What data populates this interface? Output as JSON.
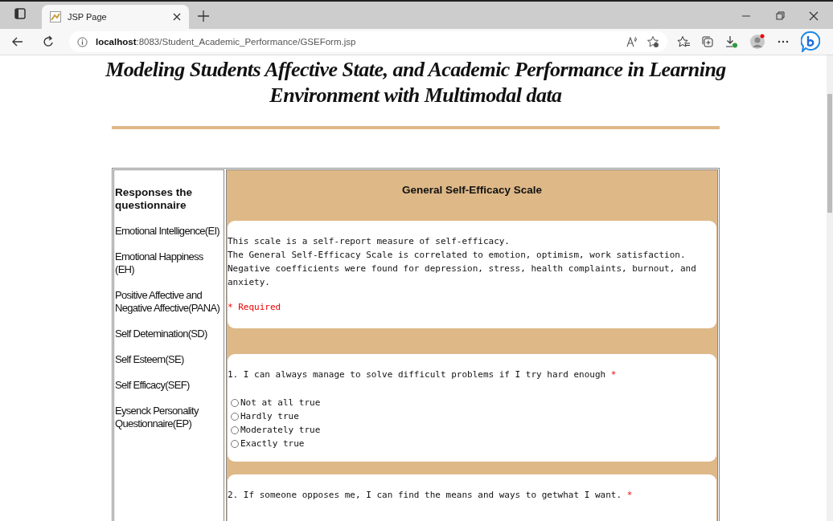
{
  "browser": {
    "tab_title": "JSP Page",
    "url_host": "localhost",
    "url_path": ":8083/Student_Academic_Performance/GSEForm.jsp"
  },
  "page": {
    "title": "Modeling Students Affective State, and Academic Performance in Learning Environment with Multimodal data"
  },
  "sidebar": {
    "heading": "Responses the questionnaire",
    "items": [
      {
        "label": "Emotional Intelligence(EI)"
      },
      {
        "label": "Emotional Happiness (EH)"
      },
      {
        "label": "Positive Affective and Negative Affective(PANA)"
      },
      {
        "label": "Self Detemination(SD)"
      },
      {
        "label": "Self Esteem(SE)"
      },
      {
        "label": "Self Efficacy(SEF)"
      },
      {
        "label": "Eysenck Personality Questionnaire(EP)"
      }
    ]
  },
  "form": {
    "heading": "General Self-Efficacy Scale",
    "description": [
      "This scale is a self-report measure of self-efficacy.",
      "The General Self-Efficacy Scale is correlated to emotion, optimism, work satisfaction. Negative coefficients were found for depression, stress, health complaints, burnout, and anxiety."
    ],
    "required_note": "* Required",
    "questions": [
      {
        "text": "1. I can always manage to solve difficult problems if I try hard enough",
        "required_mark": "*",
        "options": [
          {
            "label": "Not at all true",
            "selected": false
          },
          {
            "label": "Hardly true",
            "selected": false
          },
          {
            "label": "Moderately true",
            "selected": false
          },
          {
            "label": "Exactly true",
            "selected": false
          }
        ]
      },
      {
        "text": "2. If someone opposes me, I can find the means and ways to getwhat I want.",
        "required_mark": "*"
      }
    ]
  }
}
